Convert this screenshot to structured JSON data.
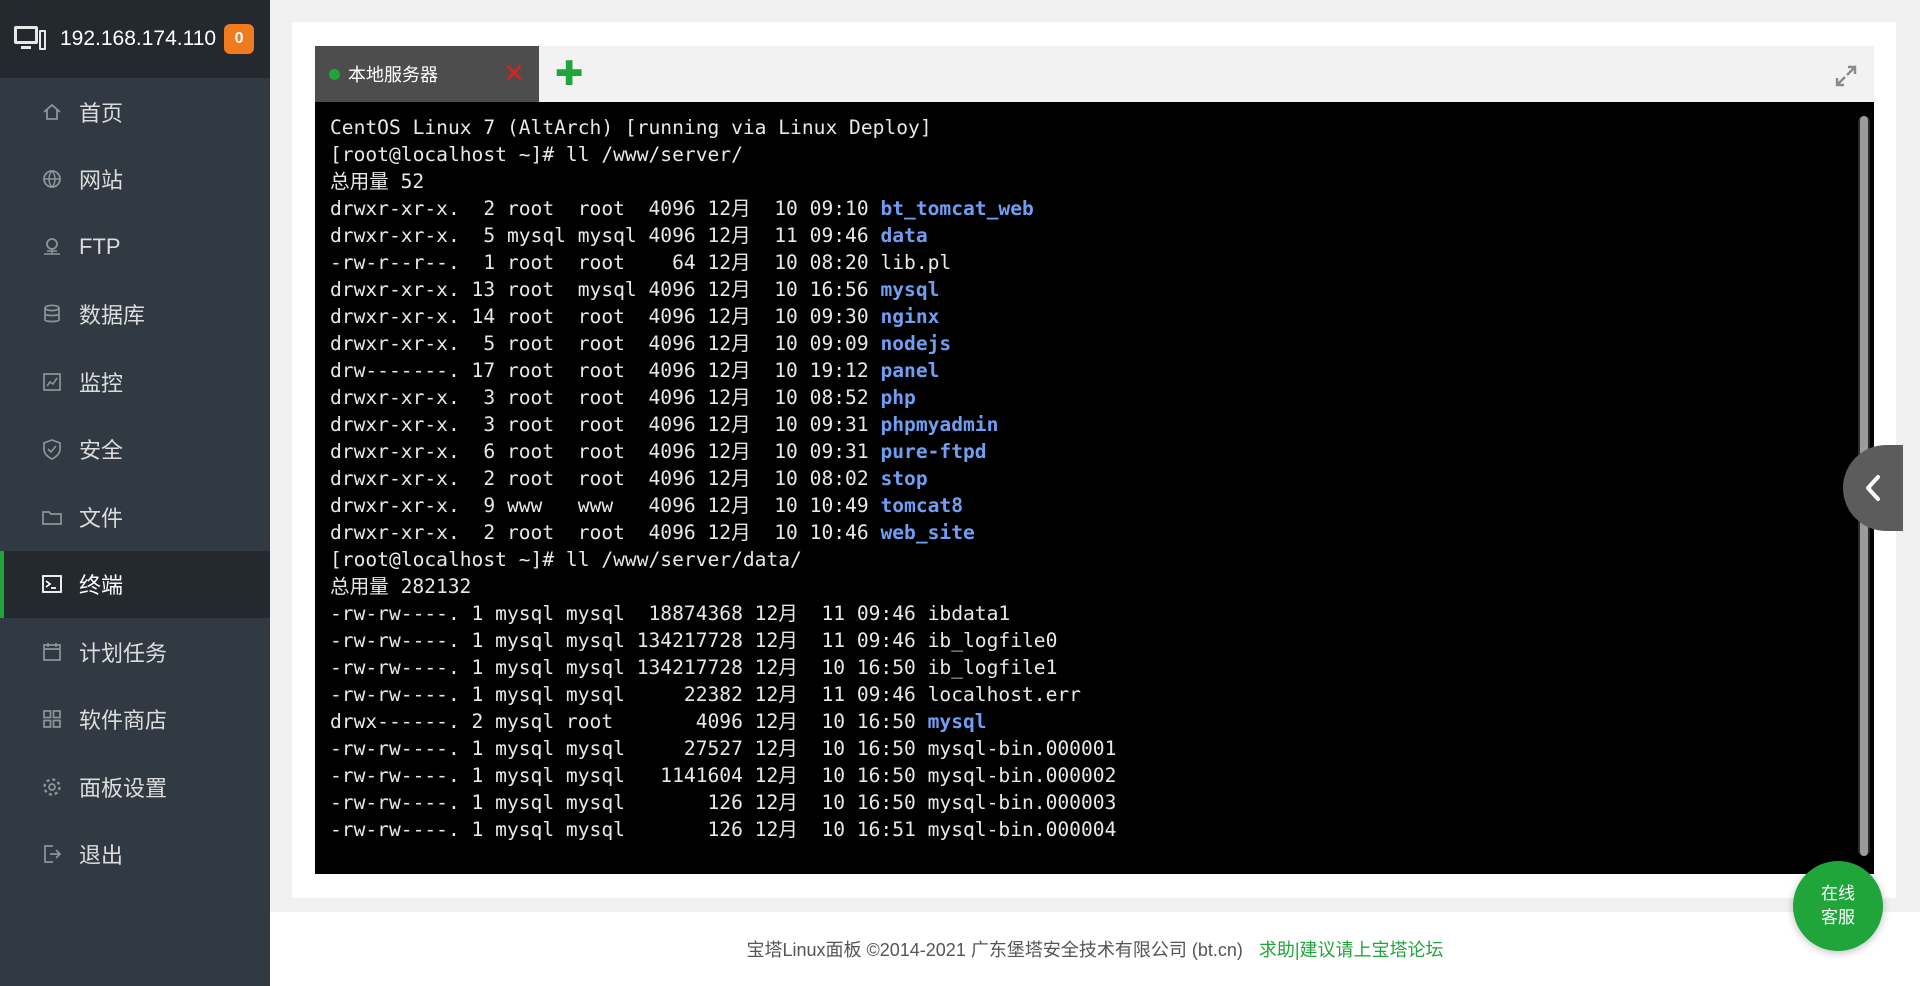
{
  "header": {
    "server_ip": "192.168.174.110",
    "notification_count": "0"
  },
  "sidebar": {
    "items": [
      {
        "label": "首页",
        "icon": "home-icon",
        "active": false
      },
      {
        "label": "网站",
        "icon": "globe-icon",
        "active": false
      },
      {
        "label": "FTP",
        "icon": "ftp-icon",
        "active": false
      },
      {
        "label": "数据库",
        "icon": "database-icon",
        "active": false
      },
      {
        "label": "监控",
        "icon": "monitor-chart-icon",
        "active": false
      },
      {
        "label": "安全",
        "icon": "shield-icon",
        "active": false
      },
      {
        "label": "文件",
        "icon": "folder-icon",
        "active": false
      },
      {
        "label": "终端",
        "icon": "terminal-icon",
        "active": true
      },
      {
        "label": "计划任务",
        "icon": "calendar-icon",
        "active": false
      },
      {
        "label": "软件商店",
        "icon": "grid-apps-icon",
        "active": false
      },
      {
        "label": "面板设置",
        "icon": "gear-icon",
        "active": false
      },
      {
        "label": "退出",
        "icon": "logout-icon",
        "active": false
      }
    ]
  },
  "terminal": {
    "tab_label": "本地服务器",
    "lines": [
      {
        "text": "CentOS Linux 7 (AltArch) [running via Linux Deploy]"
      },
      {
        "text": "[root@localhost ~]# ll /www/server/"
      },
      {
        "text": "总用量 52"
      },
      {
        "text": "drwxr-xr-x.  2 root  root  4096 12月  10 09:10 ",
        "name": "bt_tomcat_web"
      },
      {
        "text": "drwxr-xr-x.  5 mysql mysql 4096 12月  11 09:46 ",
        "name": "data"
      },
      {
        "text": "-rw-r--r--.  1 root  root    64 12月  10 08:20 lib.pl"
      },
      {
        "text": "drwxr-xr-x. 13 root  mysql 4096 12月  10 16:56 ",
        "name": "mysql"
      },
      {
        "text": "drwxr-xr-x. 14 root  root  4096 12月  10 09:30 ",
        "name": "nginx"
      },
      {
        "text": "drwxr-xr-x.  5 root  root  4096 12月  10 09:09 ",
        "name": "nodejs"
      },
      {
        "text": "drw-------. 17 root  root  4096 12月  10 19:12 ",
        "name": "panel"
      },
      {
        "text": "drwxr-xr-x.  3 root  root  4096 12月  10 08:52 ",
        "name": "php"
      },
      {
        "text": "drwxr-xr-x.  3 root  root  4096 12月  10 09:31 ",
        "name": "phpmyadmin"
      },
      {
        "text": "drwxr-xr-x.  6 root  root  4096 12月  10 09:31 ",
        "name": "pure-ftpd"
      },
      {
        "text": "drwxr-xr-x.  2 root  root  4096 12月  10 08:02 ",
        "name": "stop"
      },
      {
        "text": "drwxr-xr-x.  9 www   www   4096 12月  10 10:49 ",
        "name": "tomcat8"
      },
      {
        "text": "drwxr-xr-x.  2 root  root  4096 12月  10 10:46 ",
        "name": "web_site"
      },
      {
        "text": "[root@localhost ~]# ll /www/server/data/"
      },
      {
        "text": "总用量 282132"
      },
      {
        "text": "-rw-rw----. 1 mysql mysql  18874368 12月  11 09:46 ibdata1"
      },
      {
        "text": "-rw-rw----. 1 mysql mysql 134217728 12月  11 09:46 ib_logfile0"
      },
      {
        "text": "-rw-rw----. 1 mysql mysql 134217728 12月  10 16:50 ib_logfile1"
      },
      {
        "text": "-rw-rw----. 1 mysql mysql     22382 12月  11 09:46 localhost.err"
      },
      {
        "text": "drwx------. 2 mysql root       4096 12月  10 16:50 ",
        "name": "mysql"
      },
      {
        "text": "-rw-rw----. 1 mysql mysql     27527 12月  10 16:50 mysql-bin.000001"
      },
      {
        "text": "-rw-rw----. 1 mysql mysql   1141604 12月  10 16:50 mysql-bin.000002"
      },
      {
        "text": "-rw-rw----. 1 mysql mysql       126 12月  10 16:50 mysql-bin.000003"
      },
      {
        "text": "-rw-rw----. 1 mysql mysql       126 12月  10 16:51 mysql-bin.000004"
      }
    ]
  },
  "footer": {
    "copyright": "宝塔Linux面板 ©2014-2021 广东堡塔安全技术有限公司 (bt.cn)",
    "help_link": "求助|建议请上宝塔论坛"
  },
  "chat": {
    "line1": "在线",
    "line2": "客服"
  },
  "colors": {
    "accent": "#20a53a",
    "sidebar_bg": "#313a42",
    "sidebar_active_bg": "#24292f",
    "terminal_bg": "#000000",
    "directory_color": "#6f9ef2",
    "badge_bg": "#f07a1e",
    "close_red": "#e02020"
  }
}
